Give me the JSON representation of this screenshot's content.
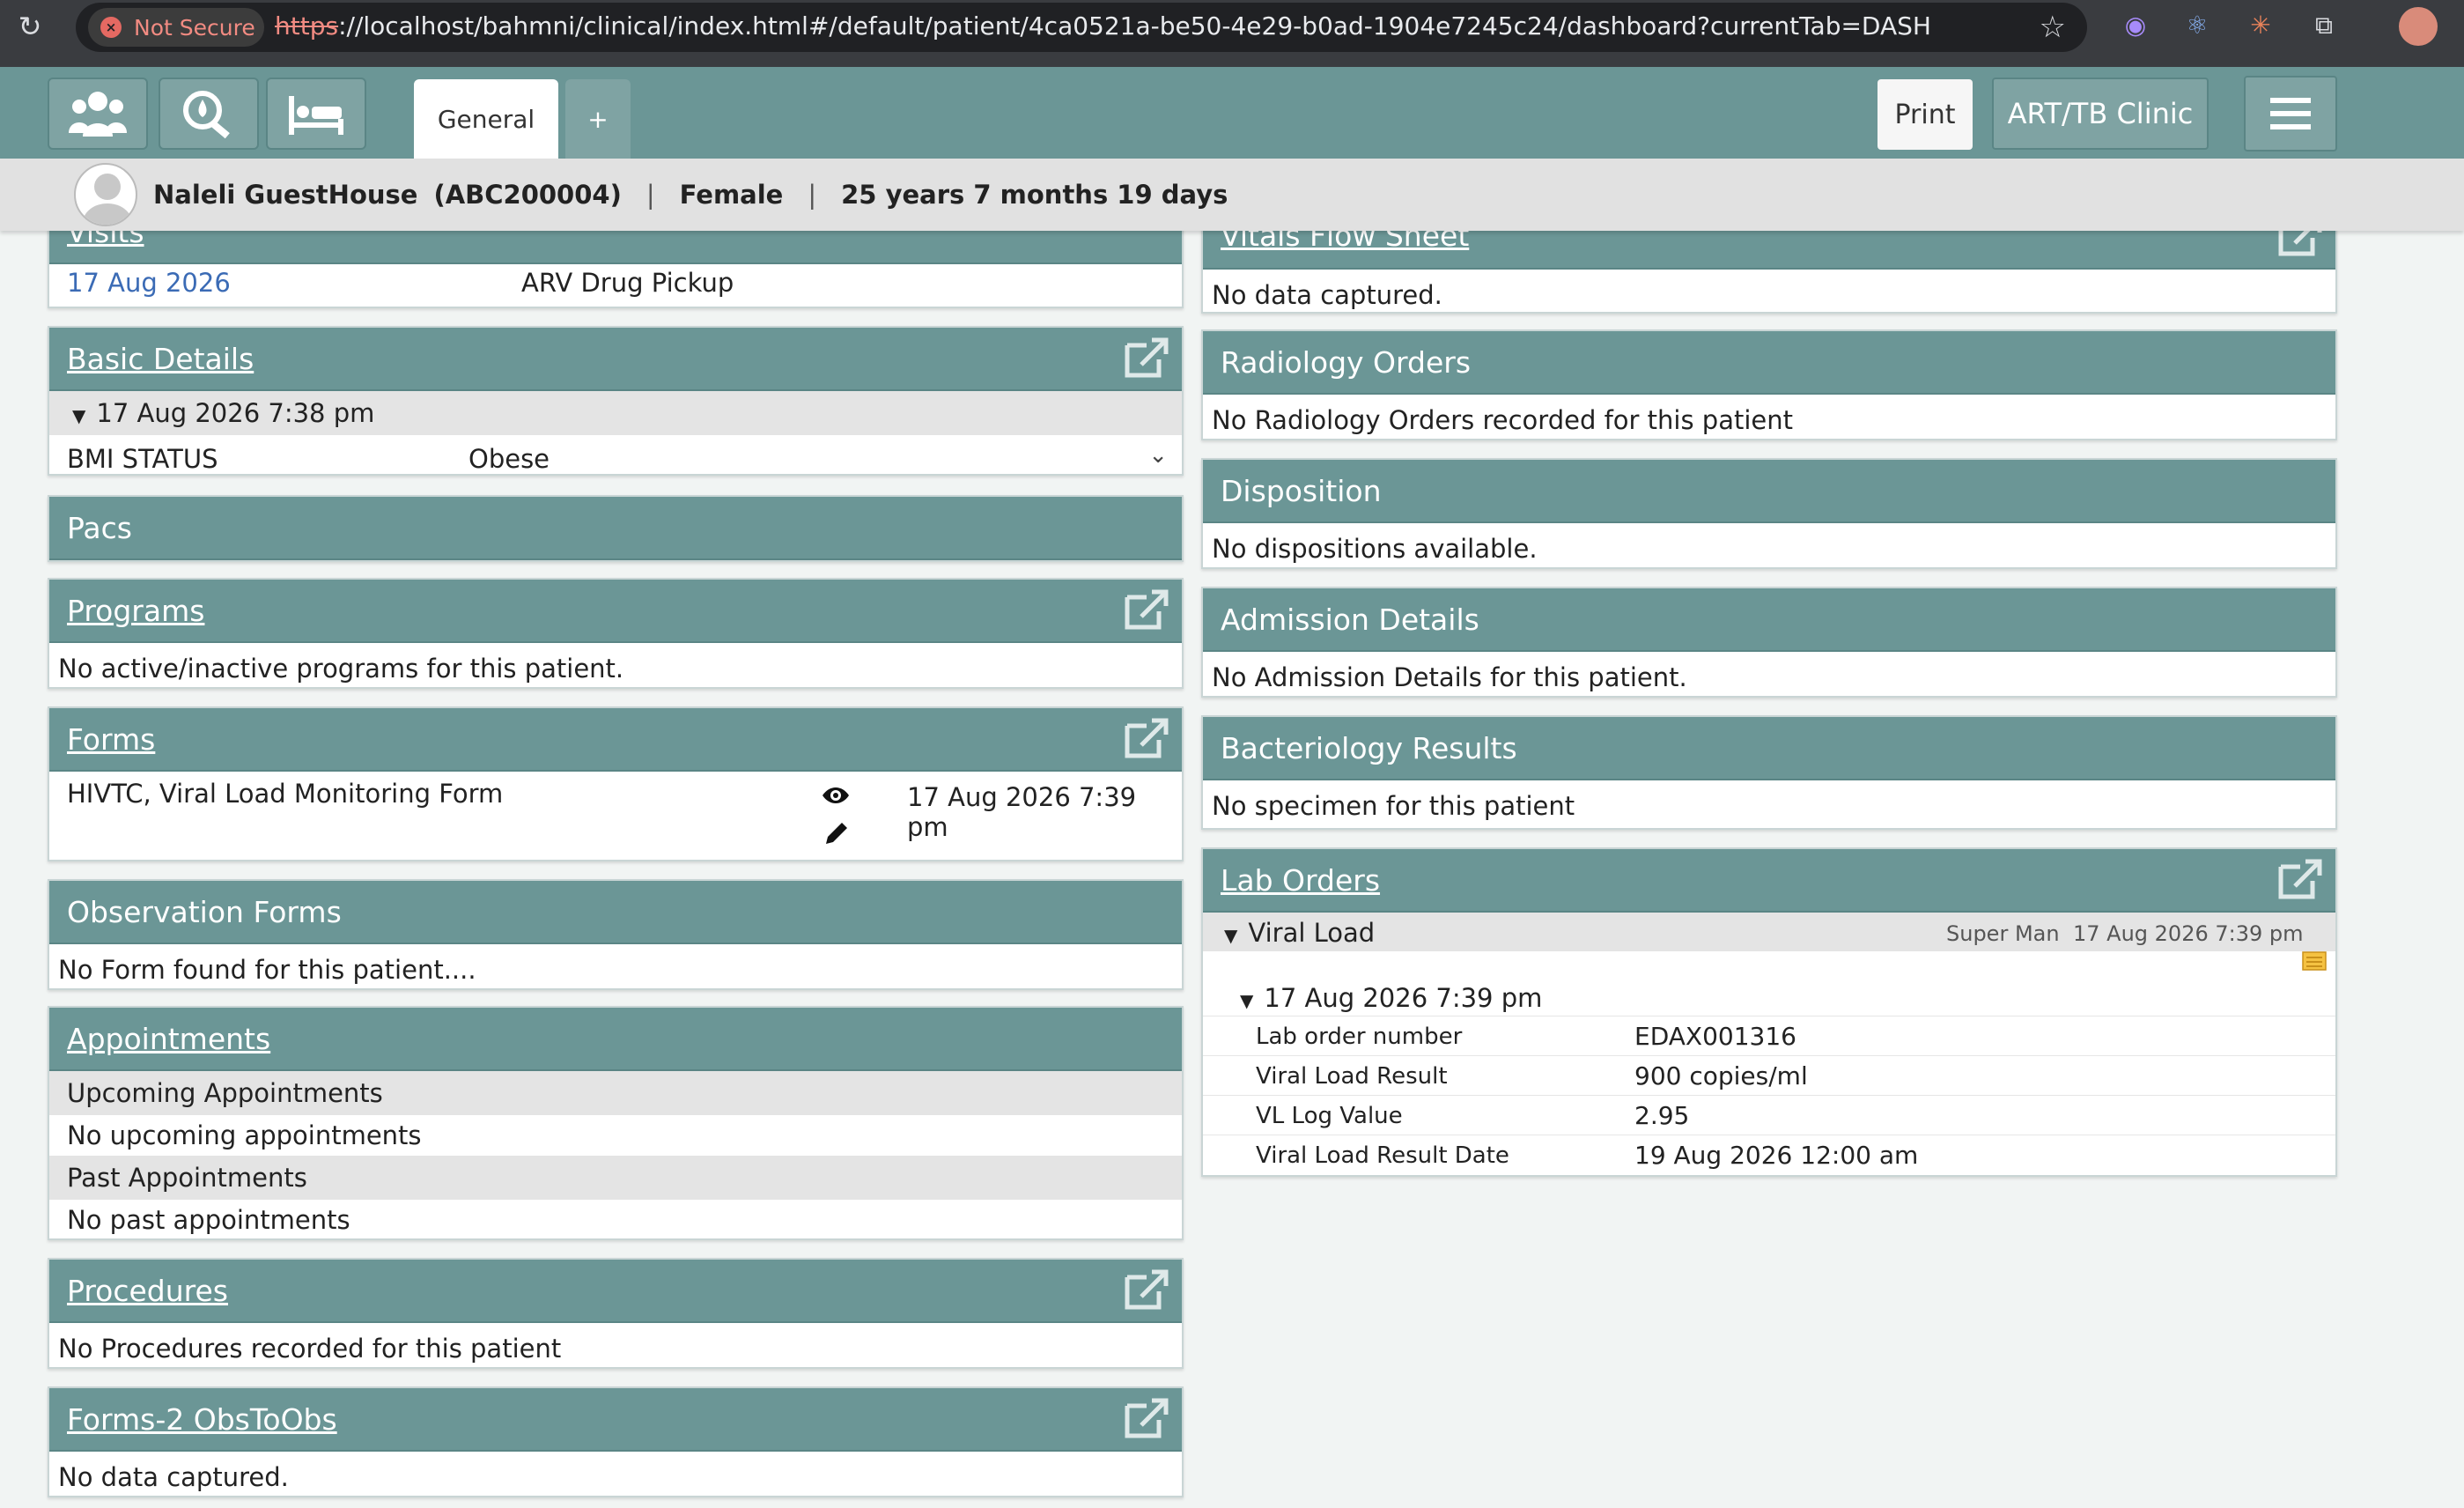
{
  "browser": {
    "security_label": "Not Secure",
    "url_protocol": "https",
    "url_rest": "://localhost/bahmni/clinical/index.html#/default/patient/4ca0521a-be50-4e29-b0ad-1904e7245c24/dashboard?currentTab=DASHBOARD_TAB..."
  },
  "header": {
    "tab_general": "General",
    "tab_add": "+",
    "print_label": "Print",
    "location_label": "ART/TB Clinic"
  },
  "patient": {
    "name": "Naleli GuestHouse",
    "id": "(ABC200004)",
    "sep": "|",
    "gender": "Female",
    "age": "25 years 7 months 19 days"
  },
  "visits": {
    "title": "Visits",
    "date": "17 Aug 2026",
    "type": "ARV Drug Pickup"
  },
  "basic_details": {
    "title": "Basic Details",
    "date": "17 Aug 2026 7:38 pm",
    "label": "BMI STATUS",
    "value": "Obese"
  },
  "pacs": {
    "title": "Pacs"
  },
  "programs": {
    "title": "Programs",
    "empty": "No active/inactive programs for this patient."
  },
  "forms": {
    "title": "Forms",
    "name": "HIVTC, Viral Load Monitoring Form",
    "date": "17 Aug 2026 7:39 pm"
  },
  "observation_forms": {
    "title": "Observation Forms",
    "empty": "No Form found for this patient...."
  },
  "appointments": {
    "title": "Appointments",
    "upcoming_label": "Upcoming Appointments",
    "upcoming_empty": "No upcoming appointments",
    "past_label": "Past Appointments",
    "past_empty": "No past appointments"
  },
  "procedures": {
    "title": "Procedures",
    "empty": "No Procedures recorded for this patient"
  },
  "forms2": {
    "title": "Forms-2 ObsToObs",
    "empty": "No data captured."
  },
  "vitals": {
    "title": "Vitals Flow Sheet",
    "empty": "No data captured."
  },
  "radiology": {
    "title": "Radiology Orders",
    "empty": "No Radiology Orders recorded for this patient"
  },
  "disposition": {
    "title": "Disposition",
    "empty": "No dispositions available."
  },
  "admission": {
    "title": "Admission Details",
    "empty": "No Admission Details for this patient."
  },
  "bacteriology": {
    "title": "Bacteriology Results",
    "empty": "No specimen for this patient"
  },
  "lab_orders": {
    "title": "Lab Orders",
    "test": "Viral Load",
    "provider": "Super Man",
    "order_date": "17 Aug 2026 7:39 pm",
    "result_date": "17 Aug 2026 7:39 pm",
    "rows": [
      {
        "label": "Lab order number",
        "value": "EDAX001316"
      },
      {
        "label": "Viral Load Result",
        "value": "900 copies/ml"
      },
      {
        "label": "VL Log Value",
        "value": "2.95"
      },
      {
        "label": "Viral Load Result Date",
        "value": "19 Aug 2026 12:00 am"
      }
    ]
  }
}
